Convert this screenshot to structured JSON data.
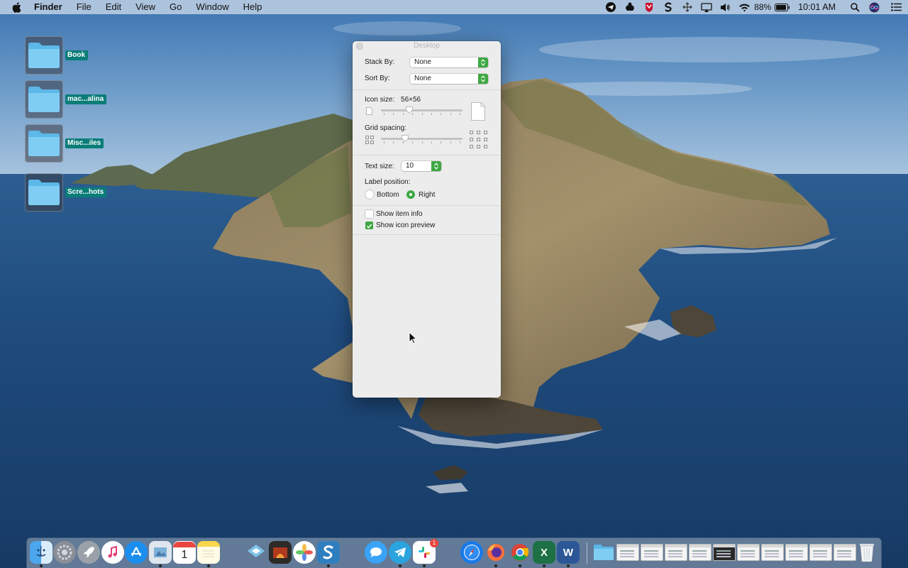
{
  "menubar": {
    "app_name": "Finder",
    "menus": [
      "File",
      "Edit",
      "View",
      "Go",
      "Window",
      "Help"
    ],
    "battery_percent": "88%",
    "clock": "10:01 AM",
    "status_icons": [
      "telegram-icon",
      "sync-icon",
      "mcafee-icon",
      "stripe-icon",
      "move-icon",
      "airplay-icon",
      "volume-icon",
      "wifi-icon",
      "battery-icon",
      "spotlight-icon",
      "siri-icon",
      "notification-center-icon"
    ]
  },
  "desktop_icons": [
    {
      "label": "Book"
    },
    {
      "label": "mac...alina"
    },
    {
      "label": "Misc...iles"
    },
    {
      "label": "Scre...hots"
    }
  ],
  "panel": {
    "title": "Desktop",
    "stack_by_label": "Stack By:",
    "stack_by_value": "None",
    "sort_by_label": "Sort By:",
    "sort_by_value": "None",
    "icon_size_label": "Icon size:",
    "icon_size_value": "56×56",
    "grid_spacing_label": "Grid spacing:",
    "text_size_label": "Text size:",
    "text_size_value": "10",
    "label_position_label": "Label position:",
    "label_position_options": [
      "Bottom",
      "Right"
    ],
    "label_position_selected": "Right",
    "show_item_info_label": "Show item info",
    "show_item_info_checked": false,
    "show_icon_preview_label": "Show icon preview",
    "show_icon_preview_checked": true,
    "icon_size_fraction": 0.3,
    "grid_spacing_fraction": 0.25
  },
  "dock": {
    "apps": [
      "finder-icon",
      "system-preferences-icon",
      "launchpad-icon",
      "itunes-icon",
      "app-store-icon",
      "preview-icon",
      "calendar-icon",
      "notes-icon",
      "xcode-like-icon",
      "photo-booth-icon",
      "photos-icon",
      "screens-icon",
      "messages-icon",
      "telegram-icon",
      "slack-icon",
      "safari-icon",
      "firefox-icon",
      "chrome-icon",
      "excel-icon",
      "word-icon"
    ],
    "calendar_day": "1",
    "slack_badge": "1"
  },
  "colors": {
    "accent": "#3ea842",
    "label_tag": "#0a7d78"
  }
}
